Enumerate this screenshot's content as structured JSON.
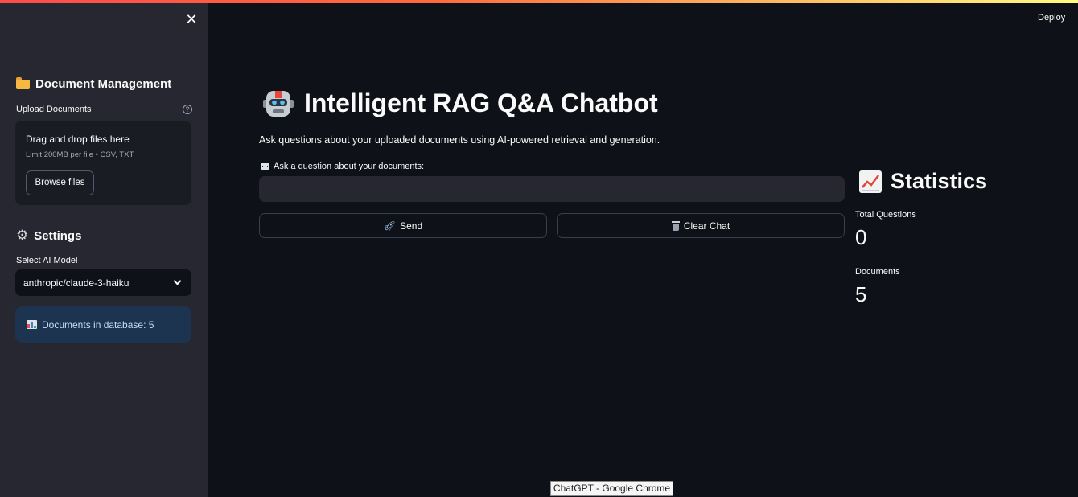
{
  "sidebar": {
    "document_management_title": "Document Management",
    "upload_label": "Upload Documents",
    "dropzone_title": "Drag and drop files here",
    "dropzone_hint": "Limit 200MB per file • CSV, TXT",
    "browse_label": "Browse files",
    "settings_title": "Settings",
    "model_label": "Select AI Model",
    "model_value": "anthropic/claude-3-haiku",
    "info_text": "Documents in database: 5"
  },
  "header": {
    "deploy_label": "Deploy"
  },
  "main": {
    "title": "Intelligent RAG Q&A Chatbot",
    "subtitle": "Ask questions about your uploaded documents using AI-powered retrieval and generation.",
    "question_label": "Ask a question about your documents:",
    "question_value": "",
    "send_label": "Send",
    "clear_label": "Clear Chat"
  },
  "stats": {
    "title": "Statistics",
    "total_questions_label": "Total Questions",
    "total_questions_value": "0",
    "documents_label": "Documents",
    "documents_value": "5"
  },
  "tooltip": {
    "text": "ChatGPT - Google Chrome"
  },
  "colors": {
    "background": "#0e1117",
    "sidebar": "#262730",
    "info_box": "#1c3450",
    "accent": "#ff4b4b"
  }
}
